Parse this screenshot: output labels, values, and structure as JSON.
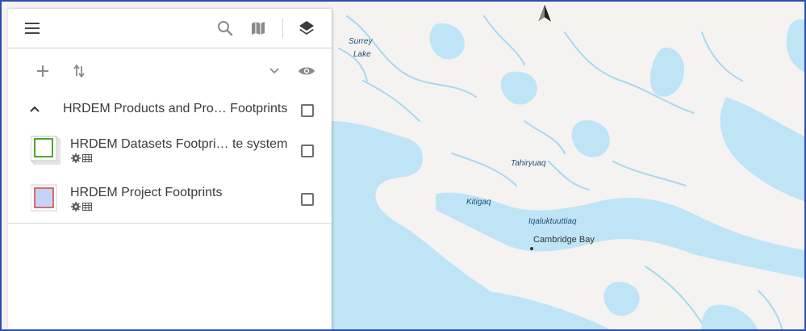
{
  "map": {
    "labels": {
      "surrey_lake_line1": "Surrey",
      "surrey_lake_line2": "Lake",
      "tahiryuaq": "Tahiryuaq",
      "kitigaq": "Kitigaq",
      "iqaluktuuttiaq": "Iqaluktuuttiaq",
      "cambridge_bay": "Cambridge Bay"
    },
    "colors": {
      "land": "#f4f3f1",
      "water": "#bfe4f6",
      "river": "#a9d8f0"
    }
  },
  "toolbar": {
    "menu_icon": "hamburger-menu-icon",
    "search_icon": "search-icon",
    "basemap_icon": "map-icon",
    "layers_icon": "layers-icon"
  },
  "layer_tools": {
    "add_icon": "plus-icon",
    "sort_icon": "sort-arrows-icon",
    "expand_icon": "chevron-down-icon",
    "visibility_icon": "eye-icon"
  },
  "layer_group": {
    "title": "HRDEM Products and Pro… Footprints",
    "layers": [
      {
        "name": "HRDEM Datasets Footpri… te system",
        "legend_color": "#4ca82c",
        "icons": [
          "gear-icon",
          "table-icon"
        ]
      },
      {
        "name": "HRDEM Project Footprints",
        "legend_color": "#c5d3f5",
        "outline": "#d0443c",
        "icons": [
          "gear-icon",
          "table-icon"
        ]
      }
    ]
  }
}
